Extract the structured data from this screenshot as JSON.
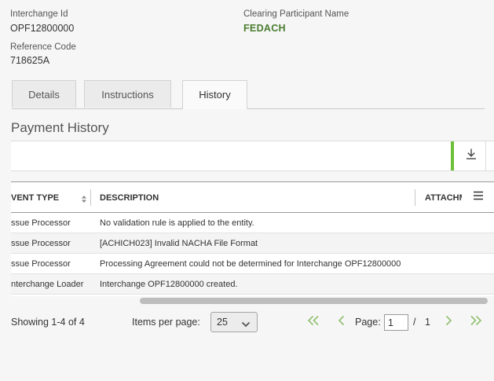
{
  "summary": {
    "interchange_id_label": "Interchange Id",
    "interchange_id_value": "OPF12800000",
    "participant_label": "Clearing Participant Name",
    "participant_value": "FEDACH",
    "reference_label": "Reference Code",
    "reference_value": "718625A"
  },
  "tabs": [
    {
      "label": "Details",
      "active": false
    },
    {
      "label": "Instructions",
      "active": false
    },
    {
      "label": "History",
      "active": true
    }
  ],
  "section_title": "Payment History",
  "colors": {
    "accent": "#4a7c2f",
    "green_bar": "#6cbf3a"
  },
  "grid": {
    "columns": [
      "EVENT TYPE",
      "DESCRIPTION",
      "ATTACHMENTS"
    ],
    "columns_visible": [
      "VENT TYPE",
      "DESCRIPTION",
      "ATTACHM"
    ],
    "rows": [
      {
        "event_type": "ssue Processor",
        "description": "No validation rule is applied to the entity."
      },
      {
        "event_type": "ssue Processor",
        "description": "[ACHICH023] Invalid NACHA File Format"
      },
      {
        "event_type": "ssue Processor",
        "description": "Processing Agreement could not be determined for Interchange OPF12800000"
      },
      {
        "event_type": "nterchange Loader",
        "description": "Interchange OPF12800000 created."
      }
    ]
  },
  "pager": {
    "showing": "Showing 1-4 of 4",
    "items_per_page_label": "Items per page:",
    "items_per_page_value": "25",
    "page_label": "Page:",
    "page_value": "1",
    "page_separator": "/",
    "page_total": "1"
  },
  "icons": {
    "download": "download-icon",
    "sort": "sort-icon",
    "menu": "hamburger-menu-icon",
    "first": "double-chevron-left-icon",
    "prev": "chevron-left-icon",
    "next": "chevron-right-icon",
    "last": "double-chevron-right-icon",
    "dropdown": "chevron-down-icon"
  }
}
